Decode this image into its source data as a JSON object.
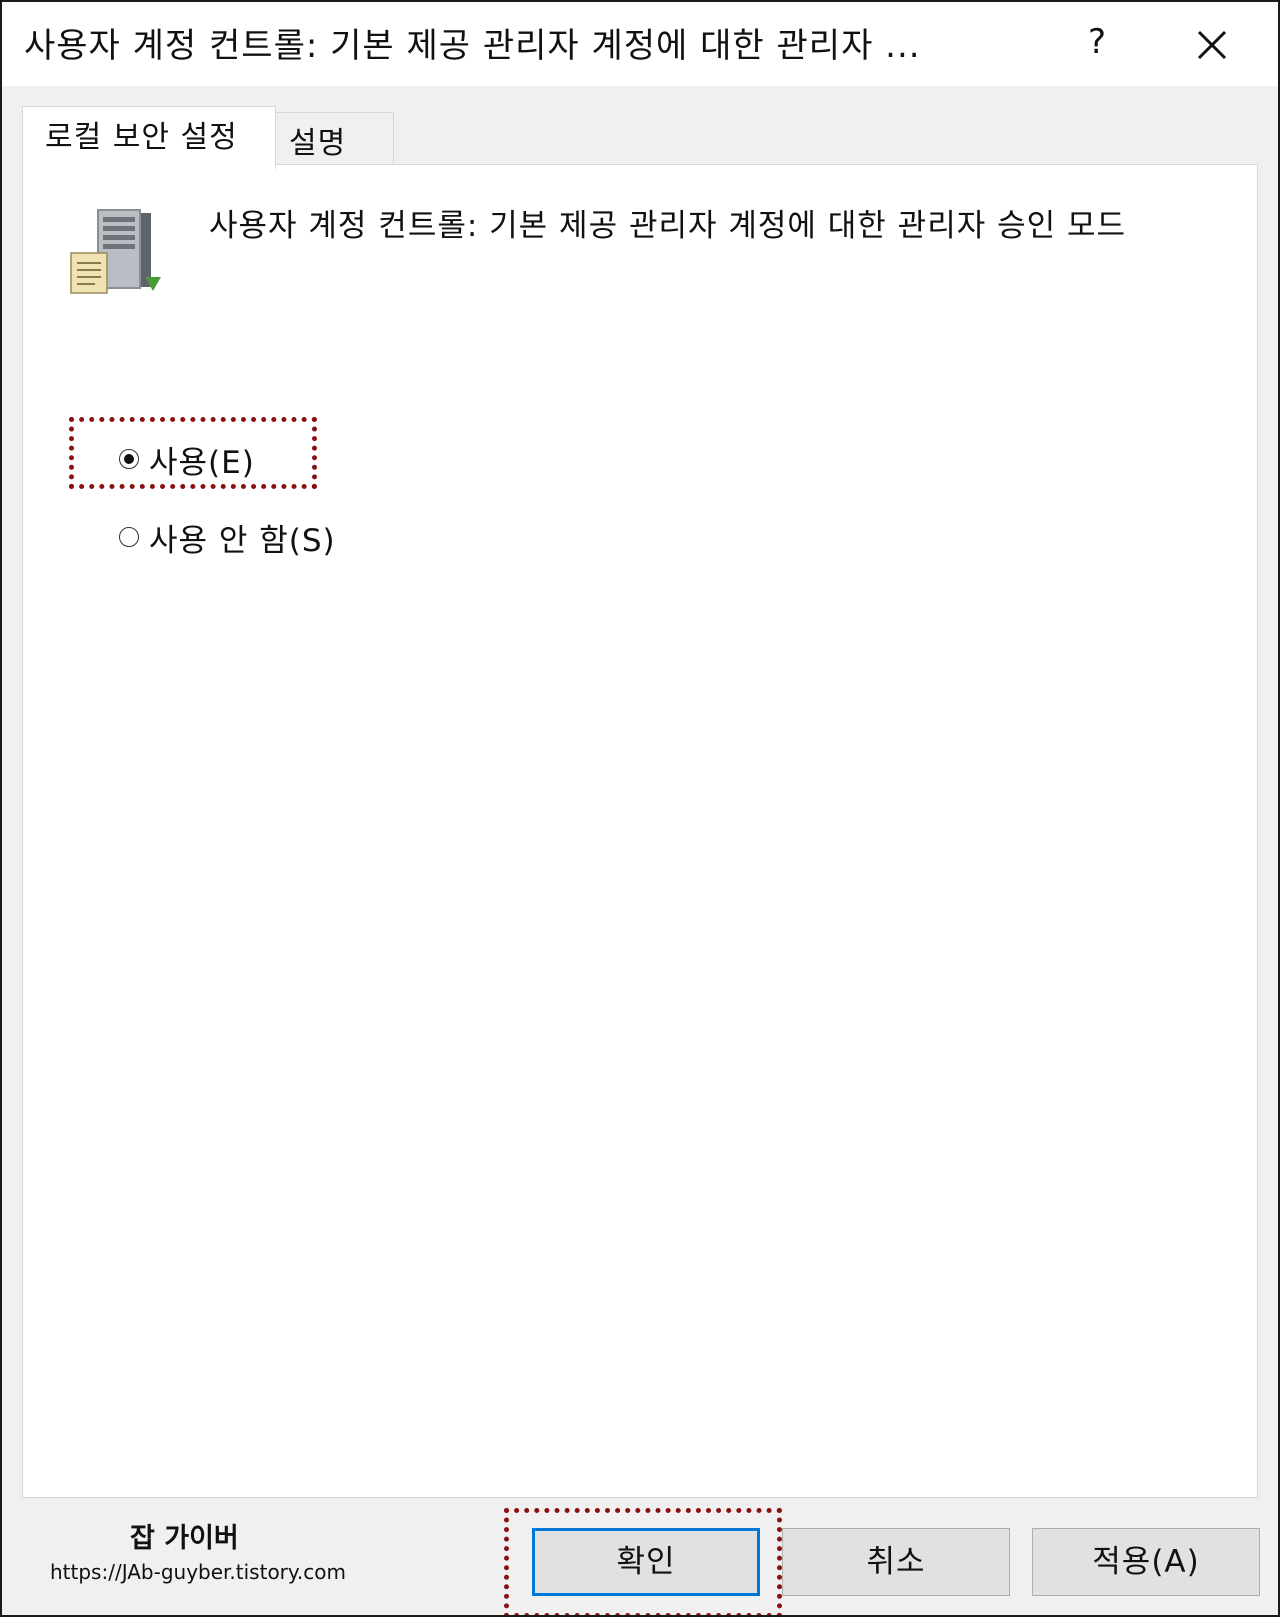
{
  "window": {
    "title": "사용자 계정 컨트롤: 기본 제공 관리자 계정에 대한 관리자 ...",
    "help_label": "?",
    "close_icon": "close-icon"
  },
  "tabs": [
    {
      "label": "로컬 보안 설정",
      "active": true
    },
    {
      "label": "설명",
      "active": false
    }
  ],
  "policy": {
    "icon": "server-policy-icon",
    "title": "사용자 계정 컨트롤: 기본 제공 관리자 계정에 대한 관리자 승인 모드"
  },
  "options": [
    {
      "label": "사용(E)",
      "selected": true
    },
    {
      "label": "사용 안 함(S)",
      "selected": false
    }
  ],
  "buttons": {
    "ok": "확인",
    "cancel": "취소",
    "apply": "적용(A)"
  },
  "watermark": {
    "title": "잡 가이버",
    "url": "https://JAb-guyber.tistory.com"
  },
  "colors": {
    "highlight": "#8b1010",
    "focus_border": "#0078d7",
    "dialog_bg": "#f0f0f0"
  }
}
